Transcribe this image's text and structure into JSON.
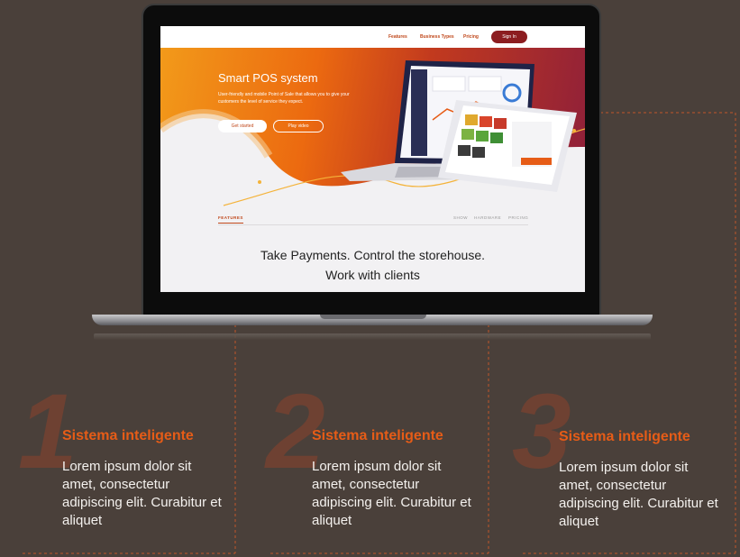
{
  "nav": {
    "features": "Features",
    "business_types": "Business Types",
    "pricing": "Pricing",
    "sign_in": "Sign In"
  },
  "hero": {
    "title": "Smart POS system",
    "subtitle": "User-friendly and mobile Point of Sale that allows you to give your customers the level of service they expect.",
    "get_started": "Get started",
    "play_video": "Play video"
  },
  "features_bar": {
    "active": "FEATURES",
    "tabs": [
      "SHOW",
      "HARDWARE",
      "PRICING"
    ]
  },
  "screen_headline": {
    "line1": "Take Payments. Control the storehouse.",
    "line2": "Work with clients"
  },
  "features": [
    {
      "number": "1",
      "title": "Sistema inteligente",
      "body": "Lorem ipsum dolor sit amet, consectetur adipiscing elit. Curabitur et aliquet"
    },
    {
      "number": "2",
      "title": "Sistema inteligente",
      "body": "Lorem ipsum dolor sit amet, consectetur adipiscing elit. Curabitur et aliquet"
    },
    {
      "number": "3",
      "title": "Sistema inteligente",
      "body": "Lorem ipsum dolor sit amet, consectetur adipiscing elit. Curabitur et aliquet"
    }
  ],
  "colors": {
    "background": "#4a403a",
    "accent": "#e65c17",
    "brand_dark_red": "#8c1d20",
    "number": "#6e4132"
  }
}
